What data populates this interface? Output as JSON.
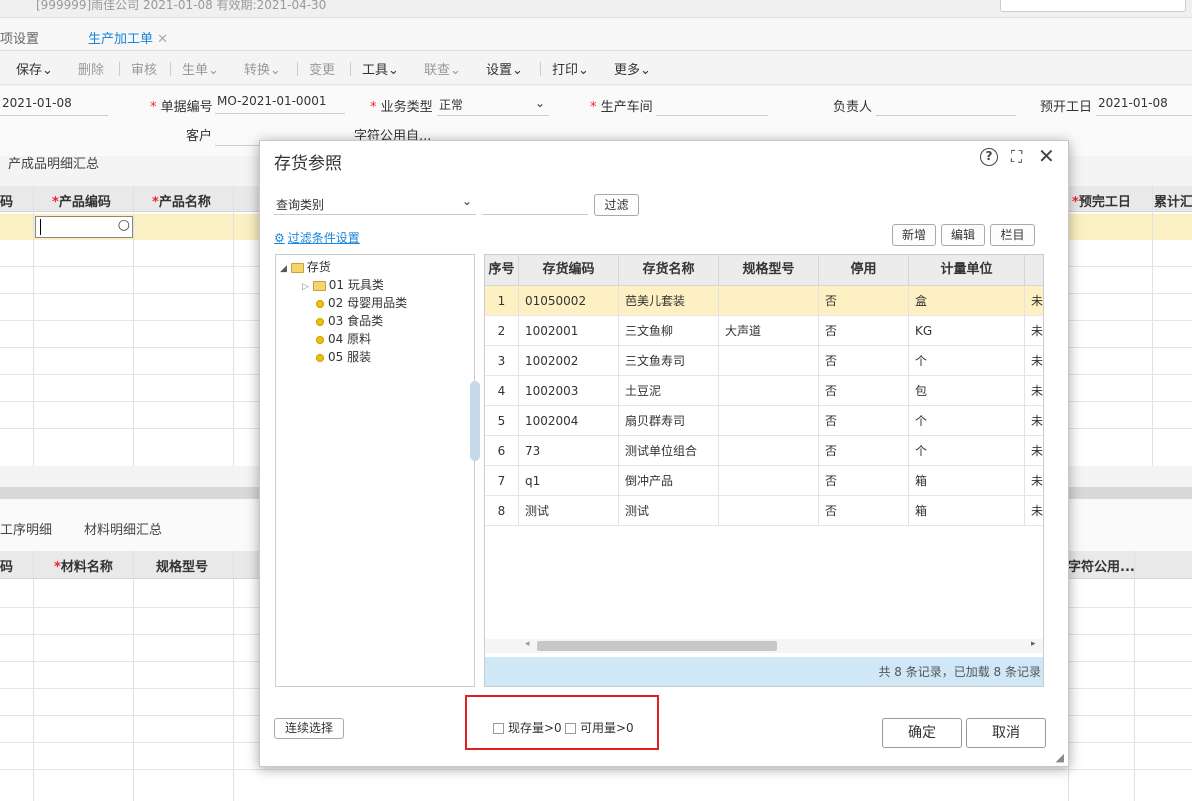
{
  "background": {
    "topbar_text": "[999999]雨佳公司    2021-01-08  有效期:2021-04-30",
    "tabs": [
      {
        "label": "项设置"
      },
      {
        "label": "生产加工单"
      }
    ],
    "toolbar": [
      "保存",
      "删除",
      "审核",
      "生单",
      "转换",
      "变更",
      "工具",
      "联查",
      "设置",
      "打印",
      "更多"
    ],
    "form": {
      "date_value": "2021-01-08",
      "doc_no_label": "单据编号",
      "doc_no_value": "MO-2021-01-0001",
      "biz_type_label": "业务类型",
      "biz_type_value": "正常",
      "workshop_label": "生产车间",
      "owner_label": "负责人",
      "plan_start_label": "预开工日",
      "plan_start_value": "2021-01-08",
      "customer_label": "客户",
      "custom_field_label": "字符公用自..."
    },
    "upper_tab": "产成品明细汇总",
    "upper_headers": [
      "码",
      "产品编码",
      "产品名称",
      "预完工日",
      "累计汇"
    ],
    "lower_tabs": [
      "工序明细",
      "材料明细汇总"
    ],
    "lower_headers": [
      "码",
      "材料名称",
      "规格型号",
      "字符公用..."
    ]
  },
  "dialog": {
    "title": "存货参照",
    "query_category": "查询类别",
    "filter_button": "过滤",
    "filter_settings_link": "过滤条件设置",
    "new_button": "新增",
    "edit_button": "编辑",
    "columns_button": "栏目",
    "tree": {
      "root": "存货",
      "children": [
        "01 玩具类",
        "02 母婴用品类",
        "03 食品类",
        "04 原料",
        "05 服装"
      ]
    },
    "table": {
      "headers": [
        "序号",
        "存货编码",
        "存货名称",
        "规格型号",
        "停用",
        "计量单位"
      ],
      "rows": [
        [
          "1",
          "01050002",
          "芭美儿套装",
          "",
          "否",
          "盒",
          "未"
        ],
        [
          "2",
          "1002001",
          "三文鱼柳",
          "大声道",
          "否",
          "KG",
          "未"
        ],
        [
          "3",
          "1002002",
          "三文鱼寿司",
          "",
          "否",
          "个",
          "未"
        ],
        [
          "4",
          "1002003",
          "土豆泥",
          "",
          "否",
          "包",
          "未"
        ],
        [
          "5",
          "1002004",
          "扇贝群寿司",
          "",
          "否",
          "个",
          "未"
        ],
        [
          "6",
          "73",
          "测试单位组合",
          "",
          "否",
          "个",
          "未"
        ],
        [
          "7",
          "q1",
          "倒冲产品",
          "",
          "否",
          "箱",
          "未"
        ],
        [
          "8",
          "测试",
          "测试",
          "",
          "否",
          "箱",
          "未"
        ]
      ]
    },
    "status_text": "共 8 条记录，已加载 8 条记录",
    "continuous_select": "连续选择",
    "checkbox_stock": "现存量>0",
    "checkbox_available": "可用量>0",
    "ok_button": "确定",
    "cancel_button": "取消"
  }
}
